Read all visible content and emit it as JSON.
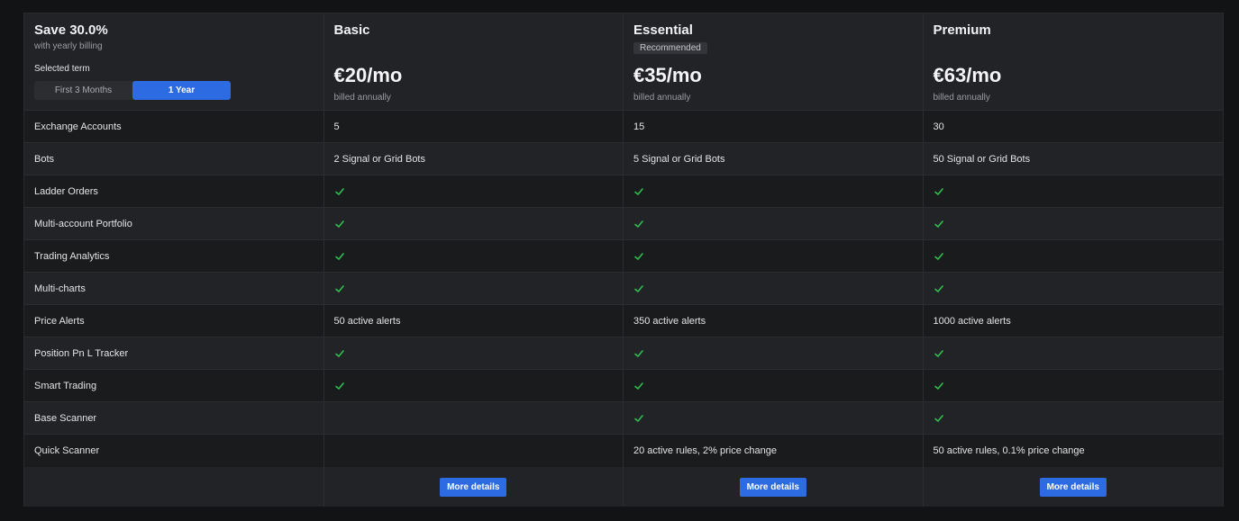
{
  "header": {
    "save_title": "Save 30.0%",
    "save_subtitle": "with yearly billing",
    "term_label": "Selected term",
    "term_options": [
      "First 3 Months",
      "1 Year"
    ],
    "selected_term": "1 Year"
  },
  "plans": [
    {
      "name": "Basic",
      "badge": "",
      "price": "€20/mo",
      "billing": "billed annually",
      "button": "More details"
    },
    {
      "name": "Essential",
      "badge": "Recommended",
      "price": "€35/mo",
      "billing": "billed annually",
      "button": "More details"
    },
    {
      "name": "Premium",
      "badge": "",
      "price": "€63/mo",
      "billing": "billed annually",
      "button": "More details"
    }
  ],
  "features": [
    {
      "label": "Exchange Accounts",
      "values": [
        "5",
        "15",
        "30"
      ]
    },
    {
      "label": "Bots",
      "values": [
        "2 Signal or Grid Bots",
        "5 Signal or Grid Bots",
        "50 Signal or Grid Bots"
      ]
    },
    {
      "label": "Ladder Orders",
      "values": [
        "check",
        "check",
        "check"
      ]
    },
    {
      "label": "Multi-account Portfolio",
      "values": [
        "check",
        "check",
        "check"
      ]
    },
    {
      "label": "Trading Analytics",
      "values": [
        "check",
        "check",
        "check"
      ]
    },
    {
      "label": "Multi-charts",
      "values": [
        "check",
        "check",
        "check"
      ]
    },
    {
      "label": "Price Alerts",
      "values": [
        "50 active alerts",
        "350 active alerts",
        "1000 active alerts"
      ]
    },
    {
      "label": "Position Pn L Tracker",
      "values": [
        "check",
        "check",
        "check"
      ]
    },
    {
      "label": "Smart Trading",
      "values": [
        "check",
        "check",
        "check"
      ]
    },
    {
      "label": "Base Scanner",
      "values": [
        "",
        "check",
        "check"
      ]
    },
    {
      "label": "Quick Scanner",
      "values": [
        "",
        "20 active rules, 2% price change",
        "50 active rules, 0.1% price change"
      ]
    }
  ],
  "colors": {
    "accent": "#2d6be3",
    "check": "#2fbf4f",
    "background": "#121315"
  }
}
